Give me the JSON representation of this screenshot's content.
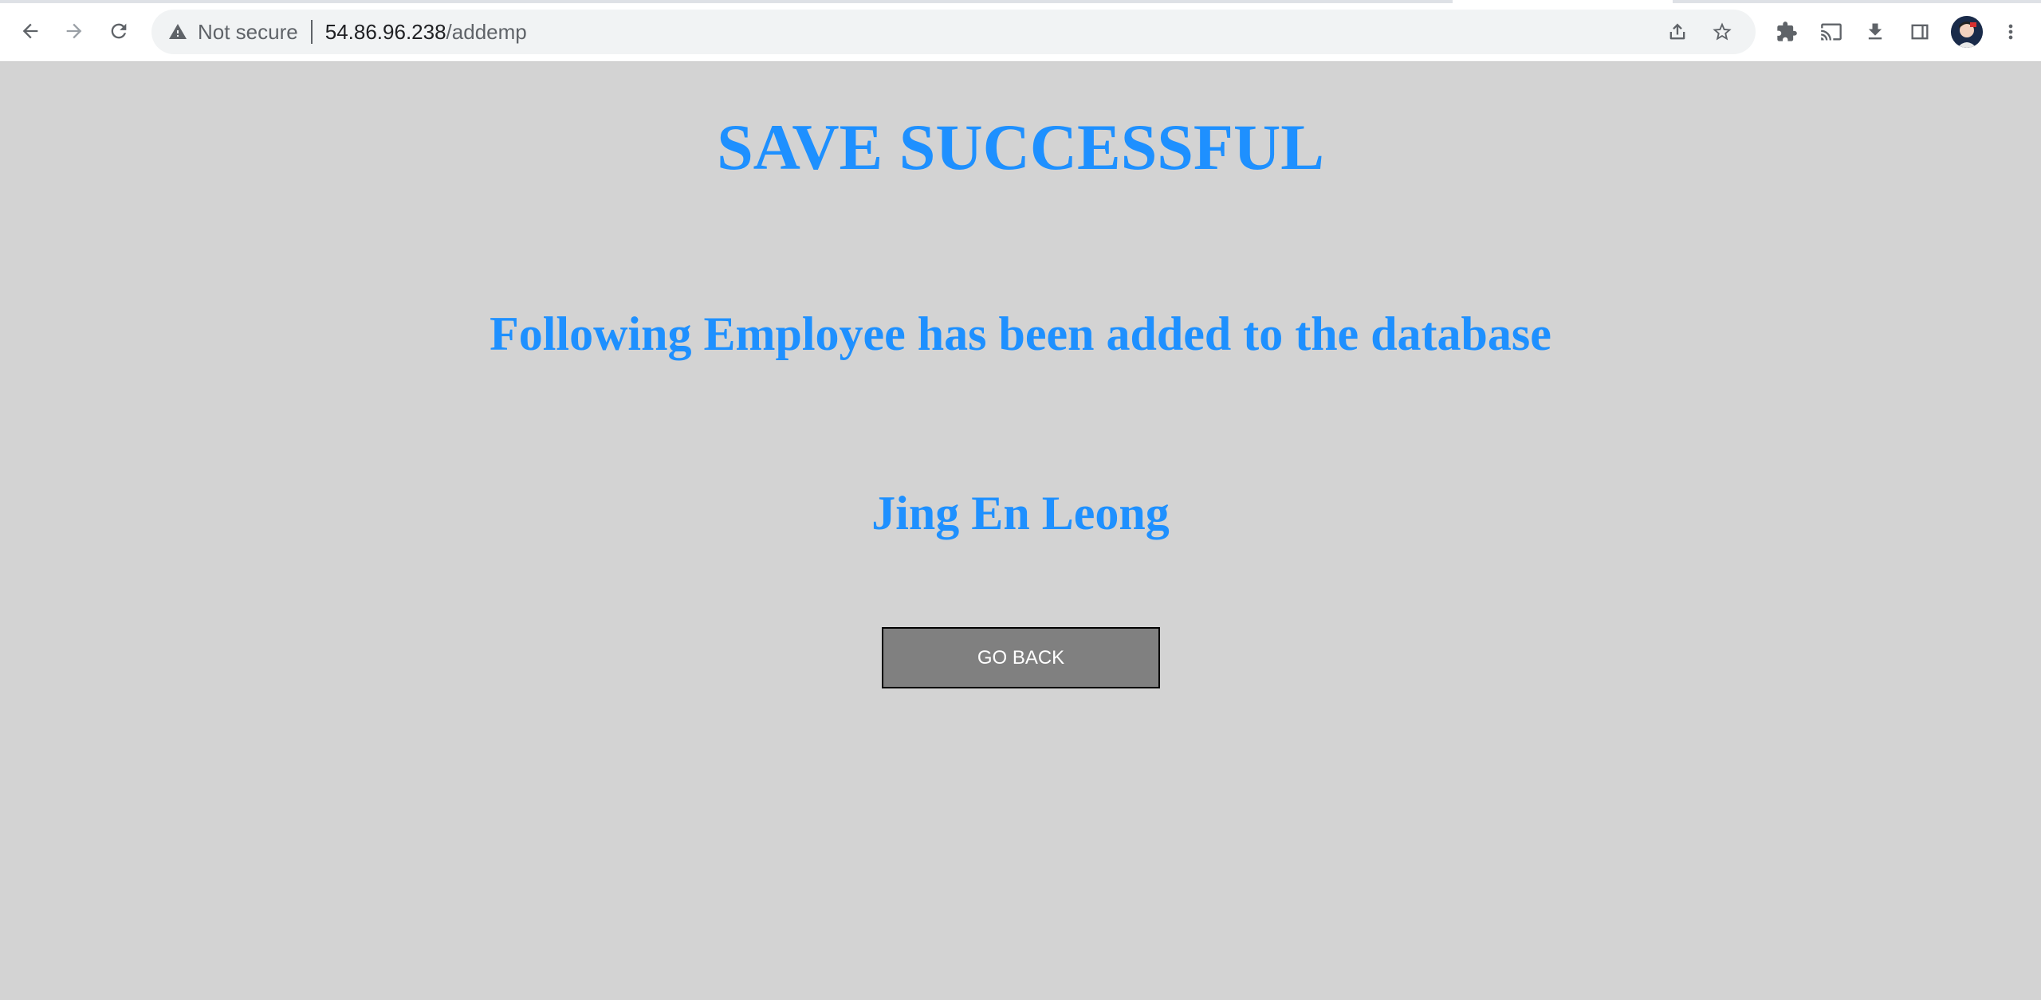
{
  "browser": {
    "security_label": "Not secure",
    "url_host": "54.86.96.238",
    "url_path": "/addemp",
    "icons": {
      "back": "arrow-left-icon",
      "forward": "arrow-right-icon",
      "reload": "reload-icon",
      "warning": "warning-triangle-icon",
      "share": "share-icon",
      "bookmark": "star-icon",
      "extensions": "puzzle-icon",
      "cast": "cast-icon",
      "download": "download-icon",
      "side_panel": "side-panel-icon",
      "menu": "more-vert-icon"
    }
  },
  "page": {
    "heading": "SAVE SUCCESSFUL",
    "message": "Following Employee has been added to the database",
    "employee_name": "Jing En Leong",
    "button_label": "GO BACK"
  },
  "colors": {
    "page_background": "#d3d3d3",
    "heading_text": "#1e90ff",
    "button_background": "#808080",
    "button_text": "#ffffff"
  }
}
